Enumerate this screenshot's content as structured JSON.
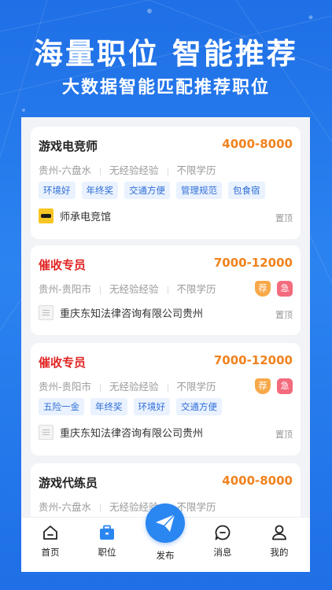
{
  "hero": {
    "title": "海量职位 智能推荐",
    "subtitle": "大数据智能匹配推荐职位"
  },
  "jobs": [
    {
      "title": "游戏电竞师",
      "salary": "4000-8000",
      "location": "贵州-六盘水",
      "experience": "无经验经验",
      "education": "不限学历",
      "tags": [
        "环境好",
        "年终奖",
        "交通方便",
        "管理规范",
        "包食宿"
      ],
      "company": "师承电竞馆",
      "pin": "置顶"
    },
    {
      "title": "催收专员",
      "salary": "7000-12000",
      "location": "贵州-贵阳市",
      "experience": "无经验经验",
      "education": "不限学历",
      "badges": [
        "荐",
        "急"
      ],
      "company": "重庆东知法律咨询有限公司贵州",
      "pin": "置顶"
    },
    {
      "title": "催收专员",
      "salary": "7000-12000",
      "location": "贵州-贵阳市",
      "experience": "无经验经验",
      "education": "不限学历",
      "badges": [
        "荐",
        "急"
      ],
      "tags": [
        "五险一金",
        "年终奖",
        "环境好",
        "交通方便"
      ],
      "company": "重庆东知法律咨询有限公司贵州",
      "pin": "置顶"
    },
    {
      "title": "游戏代练员",
      "salary": "4000-8000",
      "location": "贵州-六盘水",
      "experience": "无经验经验",
      "education": "不限学历"
    }
  ],
  "tabbar": {
    "home": "首页",
    "jobs": "职位",
    "publish": "发布",
    "messages": "消息",
    "mine": "我的"
  },
  "colors": {
    "brand_blue": "#2a86f0",
    "salary_orange": "#f0821e",
    "urgent_red": "#e22424"
  }
}
